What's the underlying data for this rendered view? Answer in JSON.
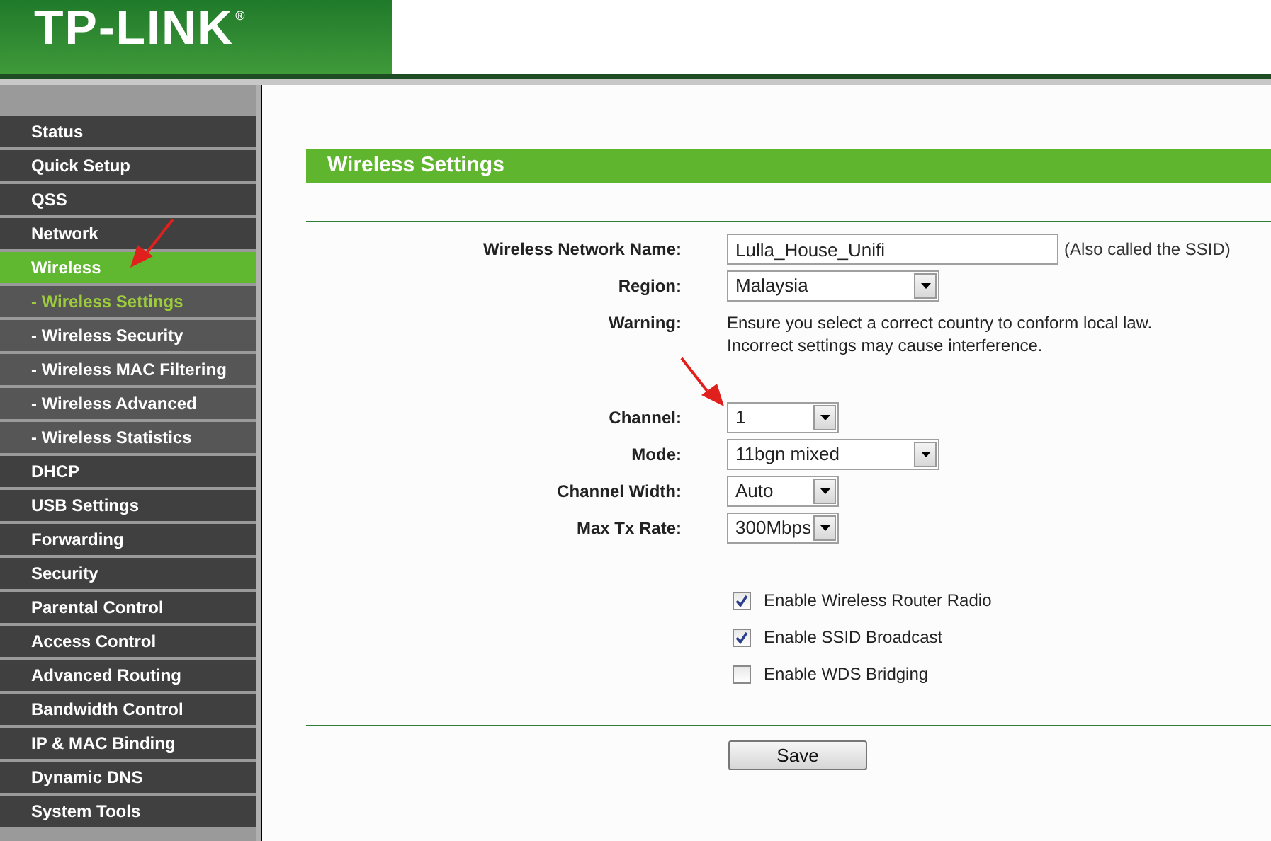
{
  "logo": {
    "text": "TP-LINK",
    "mark": "®"
  },
  "sidebar": {
    "items": [
      {
        "label": "Status",
        "kind": "main",
        "selected": false
      },
      {
        "label": "Quick Setup",
        "kind": "main",
        "selected": false
      },
      {
        "label": "QSS",
        "kind": "main",
        "selected": false
      },
      {
        "label": "Network",
        "kind": "main",
        "selected": false
      },
      {
        "label": "Wireless",
        "kind": "main",
        "selected": true
      },
      {
        "label": "- Wireless Settings",
        "kind": "sub",
        "selected": true
      },
      {
        "label": "- Wireless Security",
        "kind": "sub",
        "selected": false
      },
      {
        "label": "- Wireless MAC Filtering",
        "kind": "sub",
        "selected": false
      },
      {
        "label": "- Wireless Advanced",
        "kind": "sub",
        "selected": false
      },
      {
        "label": "- Wireless Statistics",
        "kind": "sub",
        "selected": false
      },
      {
        "label": "DHCP",
        "kind": "main",
        "selected": false
      },
      {
        "label": "USB Settings",
        "kind": "main",
        "selected": false
      },
      {
        "label": "Forwarding",
        "kind": "main",
        "selected": false
      },
      {
        "label": "Security",
        "kind": "main",
        "selected": false
      },
      {
        "label": "Parental Control",
        "kind": "main",
        "selected": false
      },
      {
        "label": "Access Control",
        "kind": "main",
        "selected": false
      },
      {
        "label": "Advanced Routing",
        "kind": "main",
        "selected": false
      },
      {
        "label": "Bandwidth Control",
        "kind": "main",
        "selected": false
      },
      {
        "label": "IP & MAC Binding",
        "kind": "main",
        "selected": false
      },
      {
        "label": "Dynamic DNS",
        "kind": "main",
        "selected": false
      },
      {
        "label": "System Tools",
        "kind": "main",
        "selected": false
      }
    ]
  },
  "panel": {
    "title": "Wireless Settings",
    "fields": [
      {
        "kind": "text",
        "label": "Wireless Network Name:",
        "value": "Lulla_House_Unifi",
        "note": "(Also called the SSID)"
      },
      {
        "kind": "wide-select",
        "label": "Region:",
        "value": "Malaysia"
      },
      {
        "kind": "note",
        "label": "Warning:",
        "lines": [
          "Ensure you select a correct country to conform local law.",
          "Incorrect settings may cause interference."
        ]
      },
      {
        "kind": "select",
        "label": "Channel:",
        "value": "1"
      },
      {
        "kind": "wide-select",
        "label": "Mode:",
        "value": "11bgn mixed"
      },
      {
        "kind": "select",
        "label": "Channel Width:",
        "value": "Auto"
      },
      {
        "kind": "select",
        "label": "Max Tx Rate:",
        "value": "300Mbps"
      }
    ],
    "options": [
      {
        "label": "Enable Wireless Router Radio",
        "checked": true
      },
      {
        "label": "Enable SSID Broadcast",
        "checked": true
      },
      {
        "label": "Enable WDS Bridging",
        "checked": false
      }
    ],
    "save": "Save"
  }
}
